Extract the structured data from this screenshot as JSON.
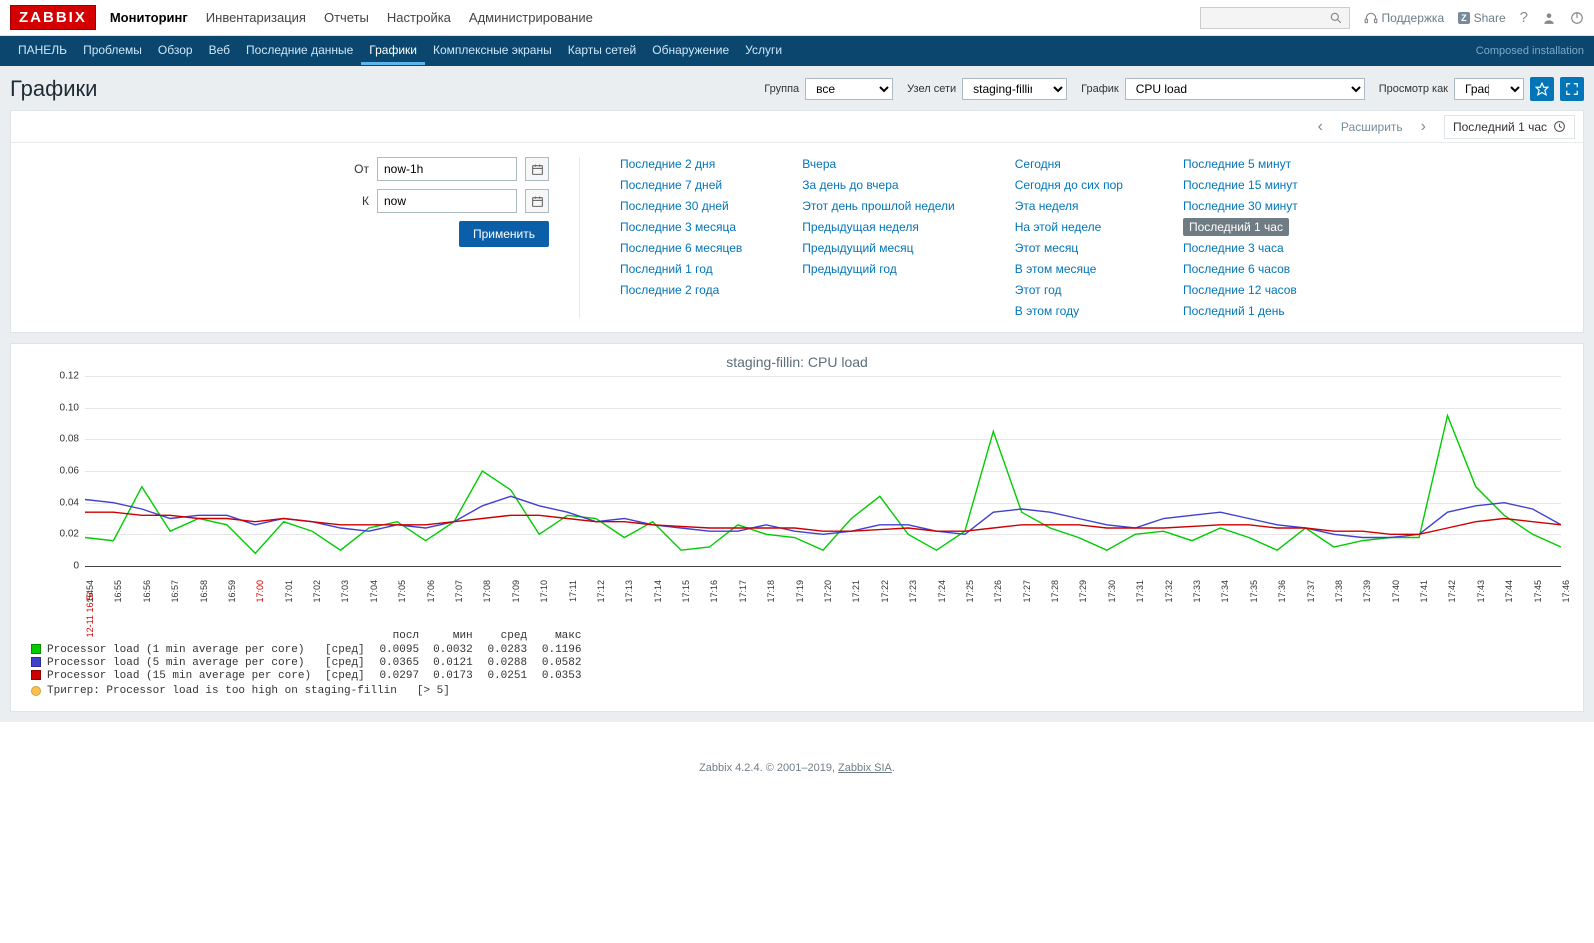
{
  "logo": "ZABBIX",
  "mainmenu": [
    "Мониторинг",
    "Инвентаризация",
    "Отчеты",
    "Настройка",
    "Администрирование"
  ],
  "mainmenu_active": 0,
  "top_right": {
    "support": "Поддержка",
    "share": "Share",
    "share_badge": "Z"
  },
  "subnav": [
    "ПАНЕЛЬ",
    "Проблемы",
    "Обзор",
    "Веб",
    "Последние данные",
    "Графики",
    "Комплексные экраны",
    "Карты сетей",
    "Обнаружение",
    "Услуги"
  ],
  "subnav_active": 5,
  "subnav_right": "Composed installation",
  "page_title": "Графики",
  "filters": {
    "group_label": "Группа",
    "group_value": "все",
    "host_label": "Узел сети",
    "host_value": "staging-fillin",
    "graph_label": "График",
    "graph_value": "CPU load",
    "view_label": "Просмотр как",
    "view_value": "График"
  },
  "timebar": {
    "expand": "Расширить",
    "current": "Последний 1 час",
    "from_label": "От",
    "to_label": "К",
    "from_value": "now-1h",
    "to_value": "now",
    "apply": "Применить",
    "presets_col1": [
      "Последние 2 дня",
      "Последние 7 дней",
      "Последние 30 дней",
      "Последние 3 месяца",
      "Последние 6 месяцев",
      "Последний 1 год",
      "Последние 2 года"
    ],
    "presets_col2": [
      "Вчера",
      "За день до вчера",
      "Этот день прошлой недели",
      "Предыдущая неделя",
      "Предыдущий месяц",
      "Предыдущий год"
    ],
    "presets_col3": [
      "Сегодня",
      "Сегодня до сих пор",
      "Эта неделя",
      "На этой неделе",
      "Этот месяц",
      "В этом месяце",
      "Этот год",
      "В этом году"
    ],
    "presets_col4": [
      "Последние 5 минут",
      "Последние 15 минут",
      "Последние 30 минут",
      "Последний 1 час",
      "Последние 3 часа",
      "Последние 6 часов",
      "Последние 12 часов",
      "Последний 1 день"
    ],
    "selected_preset": "Последний 1 час"
  },
  "chart_data": {
    "type": "line",
    "title": "staging-fillin: CPU load",
    "ylabel": "",
    "xlabel": "",
    "ylim": [
      0,
      0.12
    ],
    "yticks": [
      0,
      0.02,
      0.04,
      0.06,
      0.08,
      0.1,
      0.12
    ],
    "x": [
      "16:54",
      "16:55",
      "16:56",
      "16:57",
      "16:58",
      "16:59",
      "17:00",
      "17:01",
      "17:02",
      "17:03",
      "17:04",
      "17:05",
      "17:06",
      "17:07",
      "17:08",
      "17:09",
      "17:10",
      "17:11",
      "17:12",
      "17:13",
      "17:14",
      "17:15",
      "17:16",
      "17:17",
      "17:18",
      "17:19",
      "17:20",
      "17:21",
      "17:22",
      "17:23",
      "17:24",
      "17:25",
      "17:26",
      "17:27",
      "17:28",
      "17:29",
      "17:30",
      "17:31",
      "17:32",
      "17:33",
      "17:34",
      "17:35",
      "17:36",
      "17:37",
      "17:38",
      "17:39",
      "17:40",
      "17:41",
      "17:42",
      "17:43",
      "17:44",
      "17:45",
      "17:46"
    ],
    "x_date_prefix": "12-11",
    "x_red_index": 6,
    "series": [
      {
        "name": "Processor load (1 min average per core)",
        "color": "#00CC00",
        "values": [
          0.018,
          0.016,
          0.05,
          0.022,
          0.03,
          0.026,
          0.008,
          0.028,
          0.022,
          0.01,
          0.024,
          0.028,
          0.016,
          0.028,
          0.06,
          0.048,
          0.02,
          0.032,
          0.03,
          0.018,
          0.028,
          0.01,
          0.012,
          0.026,
          0.02,
          0.018,
          0.01,
          0.03,
          0.044,
          0.02,
          0.01,
          0.022,
          0.085,
          0.034,
          0.024,
          0.018,
          0.01,
          0.02,
          0.022,
          0.016,
          0.024,
          0.018,
          0.01,
          0.024,
          0.012,
          0.016,
          0.018,
          0.018,
          0.095,
          0.05,
          0.032,
          0.02,
          0.012
        ]
      },
      {
        "name": "Processor load (5 min average per core)",
        "color": "#4040D0",
        "values": [
          0.042,
          0.04,
          0.036,
          0.03,
          0.032,
          0.032,
          0.026,
          0.03,
          0.028,
          0.024,
          0.022,
          0.026,
          0.024,
          0.028,
          0.038,
          0.044,
          0.038,
          0.034,
          0.028,
          0.03,
          0.026,
          0.024,
          0.022,
          0.022,
          0.026,
          0.022,
          0.02,
          0.022,
          0.026,
          0.026,
          0.022,
          0.02,
          0.034,
          0.036,
          0.034,
          0.03,
          0.026,
          0.024,
          0.03,
          0.032,
          0.034,
          0.03,
          0.026,
          0.024,
          0.02,
          0.018,
          0.018,
          0.02,
          0.034,
          0.038,
          0.04,
          0.036,
          0.026
        ]
      },
      {
        "name": "Processor load (15 min average per core)",
        "color": "#CC0000",
        "values": [
          0.034,
          0.034,
          0.032,
          0.032,
          0.03,
          0.03,
          0.028,
          0.03,
          0.028,
          0.026,
          0.026,
          0.026,
          0.026,
          0.028,
          0.03,
          0.032,
          0.032,
          0.03,
          0.028,
          0.028,
          0.026,
          0.025,
          0.024,
          0.024,
          0.024,
          0.024,
          0.022,
          0.022,
          0.023,
          0.024,
          0.022,
          0.022,
          0.024,
          0.026,
          0.026,
          0.026,
          0.024,
          0.024,
          0.024,
          0.025,
          0.026,
          0.026,
          0.024,
          0.024,
          0.022,
          0.022,
          0.02,
          0.02,
          0.024,
          0.028,
          0.03,
          0.028,
          0.026
        ]
      }
    ]
  },
  "legend": {
    "headers": [
      "посл",
      "мин",
      "сред",
      "макс"
    ],
    "rows": [
      {
        "color": "#00CC00",
        "name": "Processor load (1 min average per core)",
        "agg": "[сред]",
        "vals": [
          "0.0095",
          "0.0032",
          "0.0283",
          "0.1196"
        ]
      },
      {
        "color": "#4040D0",
        "name": "Processor load (5 min average per core)",
        "agg": "[сред]",
        "vals": [
          "0.0365",
          "0.0121",
          "0.0288",
          "0.0582"
        ]
      },
      {
        "color": "#CC0000",
        "name": "Processor load (15 min average per core)",
        "agg": "[сред]",
        "vals": [
          "0.0297",
          "0.0173",
          "0.0251",
          "0.0353"
        ]
      }
    ],
    "trigger": {
      "label": "Триггер: Processor load is too high on staging-fillin",
      "cond": "[> 5]"
    }
  },
  "footer": {
    "text": "Zabbix 4.2.4. © 2001–2019, ",
    "link": "Zabbix SIA"
  }
}
